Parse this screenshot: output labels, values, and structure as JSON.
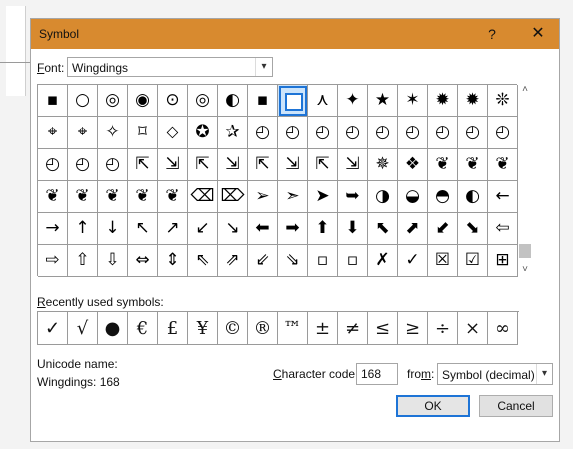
{
  "dialog": {
    "title": "Symbol",
    "help_label": "?",
    "close_label": "✕"
  },
  "font": {
    "label_prefix": "F",
    "label_rest": "ont:",
    "value": "Wingdings",
    "arrow": "▾"
  },
  "grid": {
    "selected_index": 8,
    "rows": [
      [
        "▪",
        "○",
        "◎",
        "◉",
        "⊙",
        "◎",
        "◐",
        "▪",
        "□",
        "⋏",
        "✦",
        "★",
        "✶",
        "✹",
        "✹",
        "❊"
      ],
      [
        "⌖",
        "⌖",
        "✧",
        "⌑",
        "⬦",
        "✪",
        "✰",
        "◴",
        "◴",
        "◴",
        "◴",
        "◴",
        "◴",
        "◴",
        "◴",
        "◴"
      ],
      [
        "◴",
        "◴",
        "◴",
        "⇱",
        "⇲",
        "⇱",
        "⇲",
        "⇱",
        "⇲",
        "⇱",
        "⇲",
        "✵",
        "❖",
        "❦",
        "❦",
        "❦"
      ],
      [
        "❦",
        "❦",
        "❦",
        "❦",
        "❦",
        "⌫",
        "⌦",
        "➢",
        "➣",
        "➤",
        "➥",
        "◑",
        "◒",
        "◓",
        "◐",
        "←"
      ],
      [
        "→",
        "↑",
        "↓",
        "↖",
        "↗",
        "↙",
        "↘",
        "⬅",
        "➡",
        "⬆",
        "⬇",
        "⬉",
        "⬈",
        "⬋",
        "⬊",
        "⇦"
      ],
      [
        "⇨",
        "⇧",
        "⇩",
        "⇔",
        "⇕",
        "⇖",
        "⇗",
        "⇙",
        "⇘",
        "▫",
        "▫",
        "✗",
        "✓",
        "☒",
        "☑",
        "⊞"
      ]
    ]
  },
  "recent": {
    "label_prefix": "R",
    "label_rest": "ecently used symbols:",
    "symbols": [
      "✓",
      "√",
      "●",
      "€",
      "£",
      "¥",
      "©",
      "®",
      "™",
      "±",
      "≠",
      "≤",
      "≥",
      "÷",
      "×",
      "∞"
    ]
  },
  "unicode": {
    "name_label": "Unicode name:",
    "name_value": "Wingdings: 168"
  },
  "charcode": {
    "label_prefix": "C",
    "label_rest": "haracter code:",
    "value": "168"
  },
  "from": {
    "label_prefix": "fro",
    "label_u": "m",
    "label_rest": ":",
    "value": "Symbol (decimal)",
    "arrow": "▾"
  },
  "buttons": {
    "ok": "OK",
    "cancel": "Cancel"
  },
  "scroll": {
    "up": "˄",
    "down": "˅"
  },
  "colors": {
    "titlebar": "#d88a2f",
    "accent": "#1e74d6"
  }
}
